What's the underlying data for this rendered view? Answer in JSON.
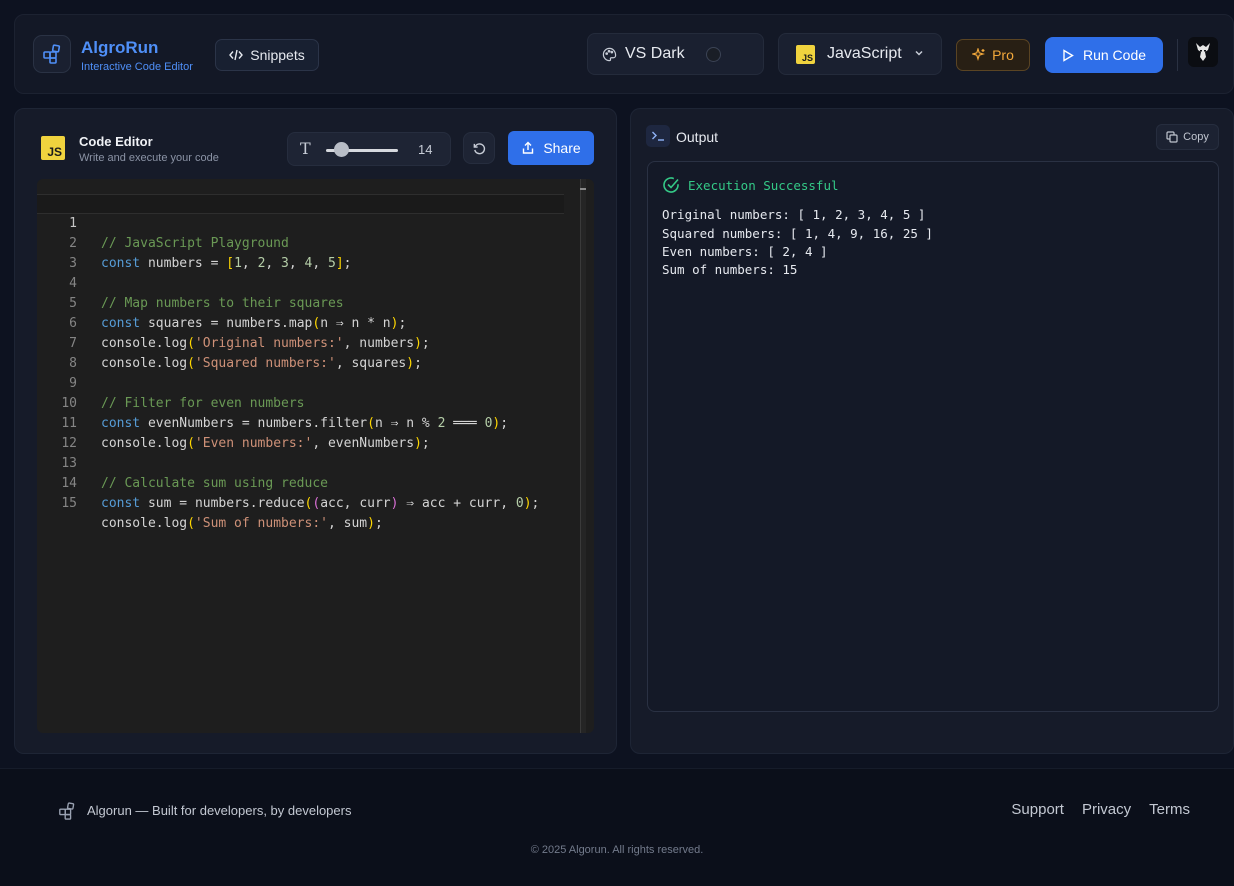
{
  "header": {
    "brand_name": "AlgroRun",
    "brand_subtitle": "Interactive Code Editor",
    "snippets_label": "Snippets",
    "theme_label": "VS Dark",
    "language_label": "JavaScript",
    "language_badge": "JS",
    "pro_label": "Pro",
    "run_label": "Run Code"
  },
  "editor": {
    "badge": "JS",
    "title": "Code Editor",
    "subtitle": "Write and execute your code",
    "font_size": "14",
    "share_label": "Share",
    "active_line": 1,
    "lines": [
      {
        "n": "1"
      },
      {
        "n": "2"
      },
      {
        "n": "3"
      },
      {
        "n": "4"
      },
      {
        "n": "5"
      },
      {
        "n": "6"
      },
      {
        "n": "7"
      },
      {
        "n": "8"
      },
      {
        "n": "9"
      },
      {
        "n": "10"
      },
      {
        "n": "11"
      },
      {
        "n": "12"
      },
      {
        "n": "13"
      },
      {
        "n": "14"
      },
      {
        "n": "15"
      }
    ],
    "code": {
      "l1": "// JavaScript Playground",
      "l4": "// Map numbers to their squares",
      "l9": "// Filter for even numbers",
      "l13": "// Calculate sum using reduce",
      "kw_const": "const",
      "numbers": "numbers",
      "squares": "squares",
      "evenNumbers": "evenNumbers",
      "sum": "sum",
      "console_log": "console.log",
      "str_original": "'Original numbers:'",
      "str_squared": "'Squared numbers:'",
      "str_even": "'Even numbers:'",
      "str_sum": "'Sum of numbers:'"
    }
  },
  "output": {
    "title": "Output",
    "copy_label": "Copy",
    "status": "Execution Successful",
    "lines": [
      "Original numbers: [ 1, 2, 3, 4, 5 ]",
      "Squared numbers: [ 1, 4, 9, 16, 25 ]",
      "Even numbers: [ 2, 4 ]",
      "Sum of numbers: 15"
    ]
  },
  "footer": {
    "brand": "Algorun — Built for developers, by developers",
    "links": [
      "Support",
      "Privacy",
      "Terms"
    ],
    "copyright": "© 2025 Algorun. All rights reserved."
  },
  "colors": {
    "accent": "#2f6fe9",
    "brand_blue": "#4f8ff7",
    "success": "#34c987",
    "pro": "#f2a83b",
    "js_yellow": "#f0d33e"
  },
  "icons": [
    "boxes-icon",
    "code-icon",
    "palette-icon",
    "chevron-down-icon",
    "sparkles-icon",
    "play-icon",
    "avatar",
    "type-icon",
    "rotate-ccw-icon",
    "share-icon",
    "terminal-icon",
    "copy-icon",
    "check-circle-icon"
  ]
}
